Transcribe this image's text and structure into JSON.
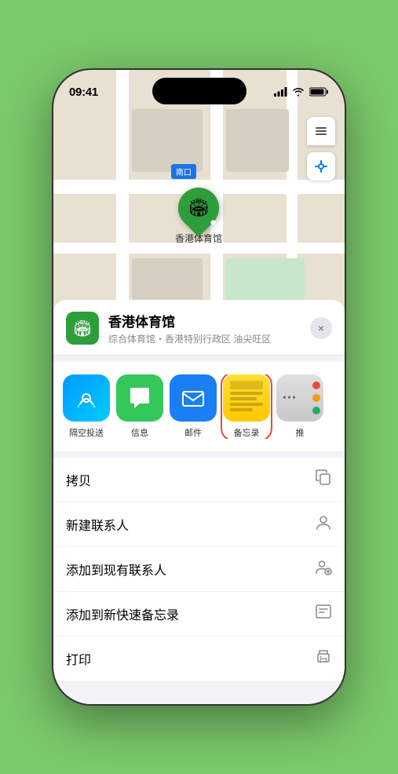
{
  "phone": {
    "status_bar": {
      "time": "09:41",
      "signal_label": "signal",
      "wifi_label": "wifi",
      "battery_label": "battery"
    },
    "map": {
      "label": "南口",
      "pin_label": "香港体育馆"
    },
    "sheet": {
      "venue_name": "香港体育馆",
      "venue_subtitle": "综合体育馆・香港特别行政区 油尖旺区",
      "close_label": "×"
    },
    "share_items": [
      {
        "id": "airdrop",
        "label": "隔空投送",
        "icon": "📶"
      },
      {
        "id": "message",
        "label": "信息",
        "icon": "💬"
      },
      {
        "id": "mail",
        "label": "邮件",
        "icon": "✉️"
      },
      {
        "id": "notes",
        "label": "备忘录",
        "icon": "📝"
      },
      {
        "id": "more",
        "label": "推",
        "icon": "···"
      }
    ],
    "actions": [
      {
        "id": "copy",
        "label": "拷贝",
        "icon": "⧉"
      },
      {
        "id": "new-contact",
        "label": "新建联系人",
        "icon": "👤"
      },
      {
        "id": "add-existing",
        "label": "添加到现有联系人",
        "icon": "👤+"
      },
      {
        "id": "add-notes",
        "label": "添加到新快速备忘录",
        "icon": "📋"
      },
      {
        "id": "print",
        "label": "打印",
        "icon": "🖨️"
      }
    ]
  }
}
